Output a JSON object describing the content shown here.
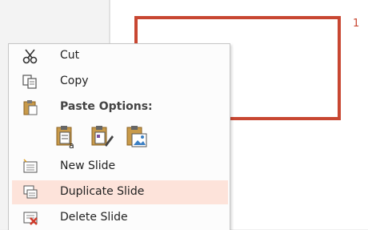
{
  "slide": {
    "number": "1"
  },
  "menu": {
    "items": [
      {
        "label": "Cut",
        "icon": "scissors-icon"
      },
      {
        "label": "Copy",
        "icon": "copy-icon"
      },
      {
        "label": "Paste Options:",
        "icon": "clipboard-icon"
      },
      {
        "label": "New Slide",
        "icon": "new-slide-icon"
      },
      {
        "label": "Duplicate Slide",
        "icon": "duplicate-slide-icon"
      },
      {
        "label": "Delete Slide",
        "icon": "delete-slide-icon"
      }
    ],
    "paste_options": [
      "use-destination-theme",
      "keep-source-formatting",
      "picture"
    ]
  },
  "colors": {
    "accent": "#c84732",
    "highlight": "#fde3da"
  }
}
